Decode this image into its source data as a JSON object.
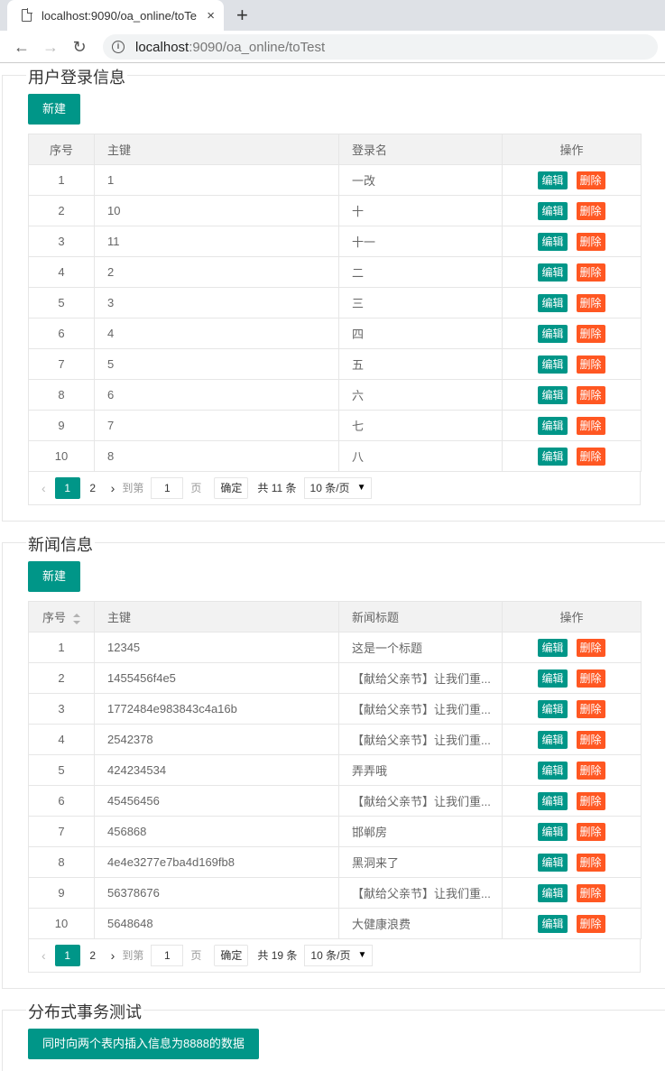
{
  "browser": {
    "tab_title": "localhost:9090/oa_online/toTe",
    "tab_close": "×",
    "new_tab": "+",
    "url_host": "localhost",
    "url_path": ":9090/oa_online/toTest",
    "back": "←",
    "forward": "→",
    "reload": "↻",
    "info": "i"
  },
  "user_section": {
    "legend": "用户登录信息",
    "new_button": "新建",
    "columns": [
      "序号",
      "主键",
      "登录名",
      "操作"
    ],
    "rows": [
      [
        "1",
        "1",
        "一改"
      ],
      [
        "2",
        "10",
        "十"
      ],
      [
        "3",
        "11",
        "十一"
      ],
      [
        "4",
        "2",
        "二"
      ],
      [
        "5",
        "3",
        "三"
      ],
      [
        "6",
        "4",
        "四"
      ],
      [
        "7",
        "5",
        "五"
      ],
      [
        "8",
        "6",
        "六"
      ],
      [
        "9",
        "7",
        "七"
      ],
      [
        "10",
        "8",
        "八"
      ]
    ],
    "edit_label": "编辑",
    "delete_label": "删除",
    "pager": {
      "prev": "‹",
      "current": "1",
      "page2": "2",
      "next": "›",
      "goto": "到第",
      "page_input": "1",
      "page_unit": "页",
      "confirm": "确定",
      "total": "共 11 条",
      "size": "10 条/页"
    }
  },
  "news_section": {
    "legend": "新闻信息",
    "new_button": "新建",
    "columns": [
      "序号",
      "主键",
      "新闻标题",
      "操作"
    ],
    "rows": [
      [
        "1",
        "12345",
        "这是一个标题"
      ],
      [
        "2",
        "1455456f4e5",
        "【献给父亲节】让我们重..."
      ],
      [
        "3",
        "1772484e983843c4a16b",
        "【献给父亲节】让我们重..."
      ],
      [
        "4",
        "2542378",
        "【献给父亲节】让我们重..."
      ],
      [
        "5",
        "424234534",
        "弄弄哦"
      ],
      [
        "6",
        "45456456",
        "【献给父亲节】让我们重..."
      ],
      [
        "7",
        "456868",
        "邯郸房"
      ],
      [
        "8",
        "4e4e3277e7ba4d169fb8",
        "黑洞来了"
      ],
      [
        "9",
        "56378676",
        "【献给父亲节】让我们重..."
      ],
      [
        "10",
        "5648648",
        "大健康浪费"
      ]
    ],
    "edit_label": "编辑",
    "delete_label": "删除",
    "pager": {
      "prev": "‹",
      "current": "1",
      "page2": "2",
      "next": "›",
      "goto": "到第",
      "page_input": "1",
      "page_unit": "页",
      "confirm": "确定",
      "total": "共 19 条",
      "size": "10 条/页"
    }
  },
  "tx_section": {
    "legend": "分布式事务测试",
    "button": "同时向两个表内插入信息为8888的数据"
  },
  "colors": {
    "primary": "#009688",
    "danger": "#ff5722",
    "border": "#e6e6e6",
    "header_bg": "#f2f2f2"
  }
}
